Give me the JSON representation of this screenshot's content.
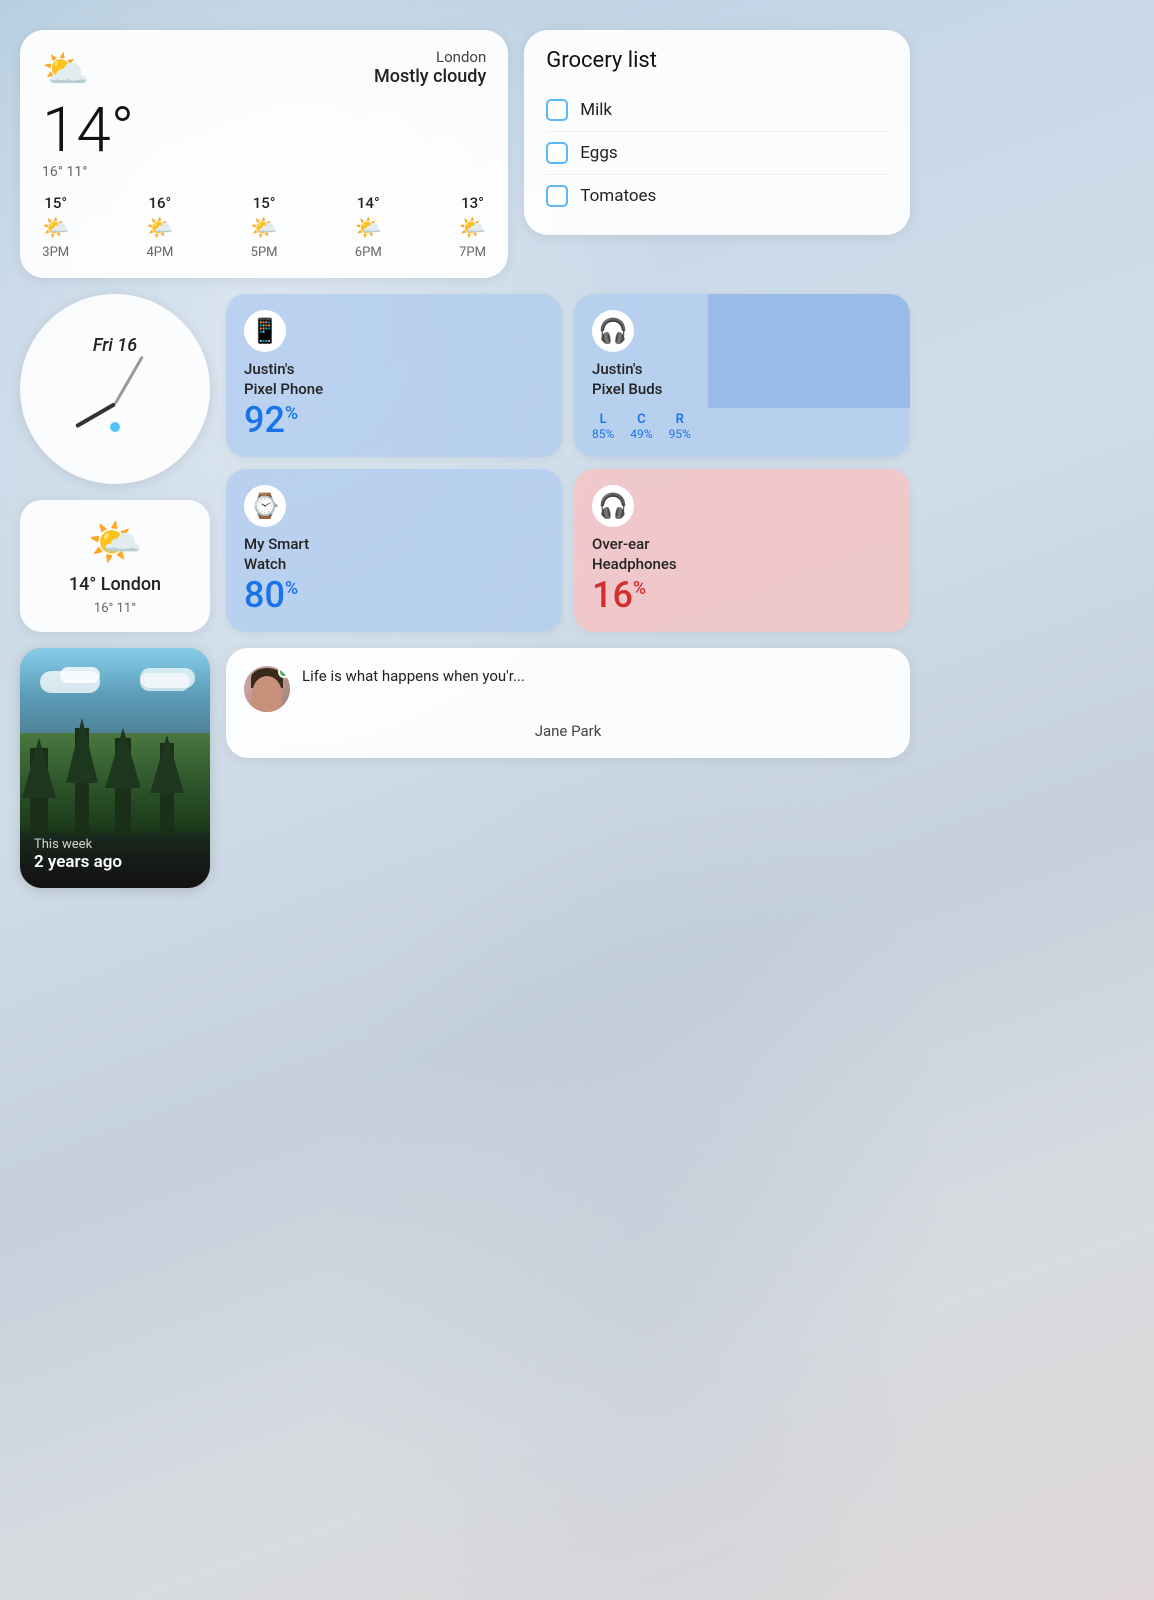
{
  "weather": {
    "city": "London",
    "description": "Mostly cloudy",
    "temp_current": "14°",
    "temp_high": "16°",
    "temp_low": "11°",
    "forecast": [
      {
        "time": "3PM",
        "temp": "15°",
        "icon": "🌤️"
      },
      {
        "time": "4PM",
        "temp": "16°",
        "icon": "🌤️"
      },
      {
        "time": "5PM",
        "temp": "15°",
        "icon": "🌤️"
      },
      {
        "time": "6PM",
        "temp": "14°",
        "icon": "🌤️"
      },
      {
        "time": "7PM",
        "temp": "13°",
        "icon": "🌤️"
      }
    ]
  },
  "grocery": {
    "title": "Grocery list",
    "items": [
      "Milk",
      "Eggs",
      "Tomatoes"
    ]
  },
  "clock": {
    "date_label": "Fri 16"
  },
  "small_weather": {
    "temp_city": "14° London",
    "hi_lo": "16° 11°"
  },
  "devices": [
    {
      "name": "Justin's\nPixel Phone",
      "percent": "92%",
      "icon": "📱",
      "type": "phone",
      "low": false
    },
    {
      "name": "Justin's\nPixel Buds",
      "icon": "🎧",
      "type": "buds",
      "low": false,
      "levels": [
        {
          "label": "L",
          "pct": "85%"
        },
        {
          "label": "C",
          "pct": "49%"
        },
        {
          "label": "R",
          "pct": "95%"
        }
      ]
    },
    {
      "name": "My Smart\nWatch",
      "percent": "80%",
      "icon": "⌚",
      "type": "watch",
      "low": false
    },
    {
      "name": "Over-ear\nHeadphones",
      "percent": "16%",
      "icon": "🎧",
      "type": "headphones",
      "low": true
    }
  ],
  "memory": {
    "label_this_week": "This week",
    "label_years_ago": "2 years ago"
  },
  "message": {
    "text": "Life is what happens when you'r...",
    "sender": "Jane Park",
    "avatar_green_dot": true
  }
}
